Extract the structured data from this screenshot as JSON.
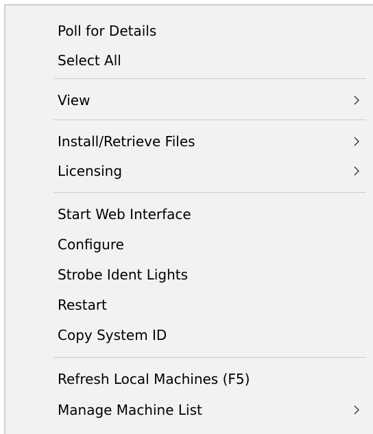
{
  "menu": {
    "items": [
      {
        "label": "Poll for Details"
      },
      {
        "label": "Select All"
      },
      {
        "label": "View"
      },
      {
        "label": "Install/Retrieve Files"
      },
      {
        "label": "Licensing"
      },
      {
        "label": "Start Web Interface"
      },
      {
        "label": "Configure"
      },
      {
        "label": "Strobe Ident Lights"
      },
      {
        "label": "Restart"
      },
      {
        "label": "Copy System ID"
      },
      {
        "label": "Refresh Local Machines (F5)"
      },
      {
        "label": "Manage Machine List"
      }
    ]
  },
  "icons": {
    "submenu_arrow": "chevron-right-icon"
  },
  "colors": {
    "menu_background": "#f2f2f2",
    "separator": "#cccccc",
    "border": "#cfcfcf",
    "text": "#000000"
  }
}
